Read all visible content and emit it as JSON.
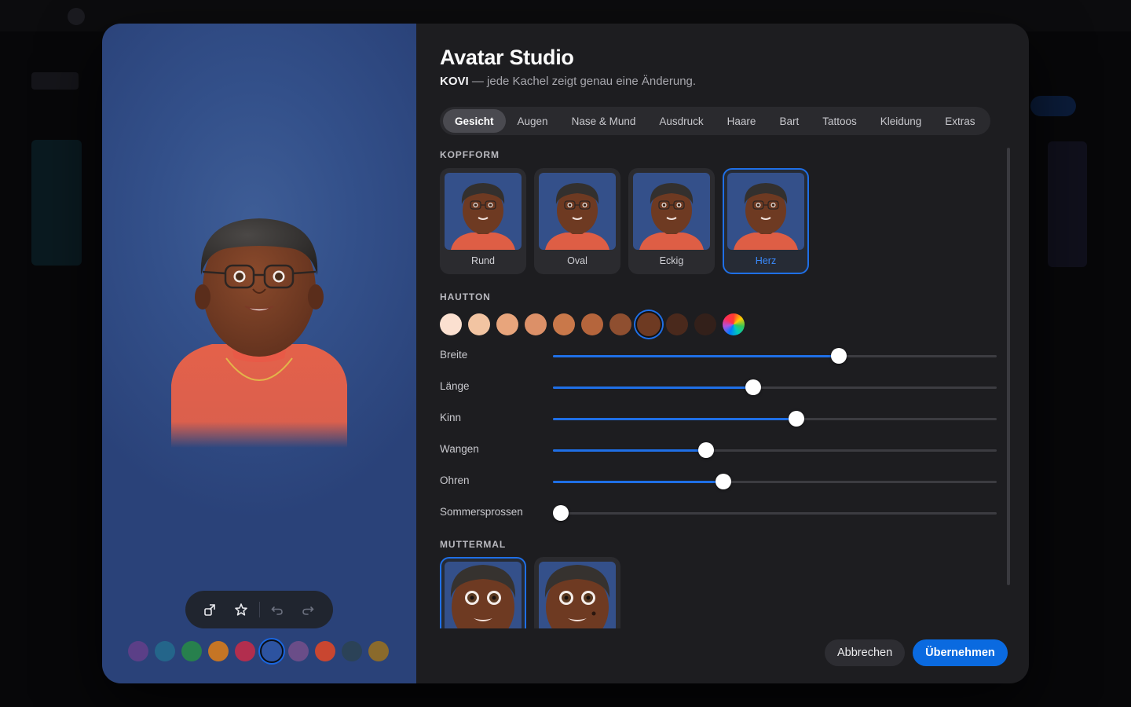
{
  "app": {
    "title": "Avatar Studio",
    "subtitle_name": "KOVI",
    "subtitle_text": "— jede Kachel zeigt genau eine Änderung."
  },
  "tabs": [
    {
      "label": "Gesicht",
      "active": true
    },
    {
      "label": "Augen"
    },
    {
      "label": "Nase & Mund"
    },
    {
      "label": "Ausdruck"
    },
    {
      "label": "Haare"
    },
    {
      "label": "Bart"
    },
    {
      "label": "Tattoos"
    },
    {
      "label": "Kleidung"
    },
    {
      "label": "Extras"
    }
  ],
  "sections": {
    "head_shape": "KOPFFORM",
    "skin_tone": "HAUTTON",
    "mole": "MUTTERMAL"
  },
  "head_shapes": [
    {
      "label": "Rund"
    },
    {
      "label": "Oval"
    },
    {
      "label": "Eckig"
    },
    {
      "label": "Herz",
      "selected": true
    }
  ],
  "skin_tones": [
    "#fbe0d0",
    "#f2c4a2",
    "#e8a57c",
    "#dc9068",
    "#c9784a",
    "#b5653c",
    "#8f4f30",
    "#6e3a22",
    "#4a291c",
    "#33201a"
  ],
  "skin_tone_selected_index": 7,
  "sliders": [
    {
      "label": "Breite",
      "value": 0.65
    },
    {
      "label": "Länge",
      "value": 0.45
    },
    {
      "label": "Kinn",
      "value": 0.55
    },
    {
      "label": "Wangen",
      "value": 0.34
    },
    {
      "label": "Ohren",
      "value": 0.38
    },
    {
      "label": "Sommersprossen",
      "value": 0.0
    }
  ],
  "mole_tiles": [
    {
      "selected": true
    },
    {
      "selected": false
    }
  ],
  "background_colors": [
    "#5b3f87",
    "#24658a",
    "#27804d",
    "#c57525",
    "#b22e4e",
    "#2d53a0",
    "#6a4d88",
    "#c94630",
    "#2b4257",
    "#8a6a2c"
  ],
  "background_selected_index": 5,
  "toolbar_icons": [
    "shapes-icon",
    "star-icon",
    "undo-icon",
    "redo-icon"
  ],
  "buttons": {
    "cancel": "Abbrechen",
    "apply": "Übernehmen"
  },
  "colors": {
    "accent": "#1f6fe6",
    "primary_button": "#0a6ae0",
    "preview_background": "#33508a"
  }
}
